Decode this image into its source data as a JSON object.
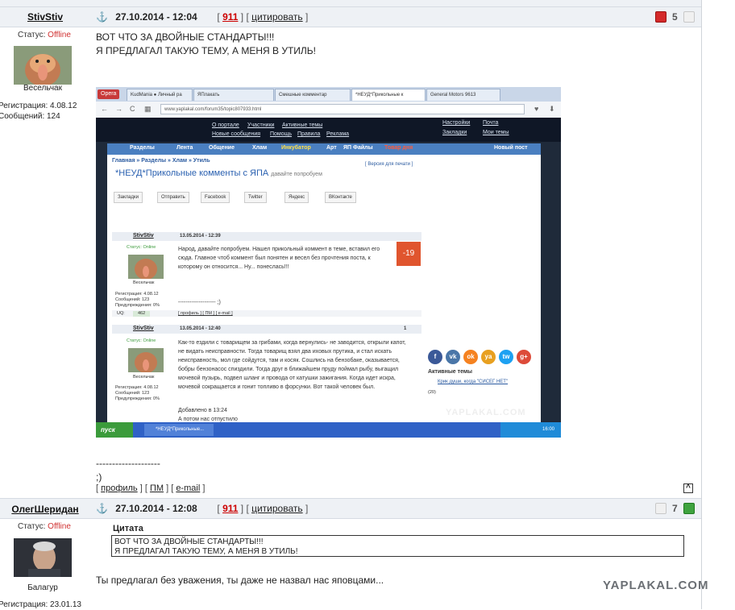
{
  "post1": {
    "author": "StivStiv",
    "status_label": "Статус:",
    "status_value": "Offline",
    "rank": "Весельчак",
    "reg": "Регистрация: 4.08.12",
    "msgs": "Сообщений: 124",
    "anchor": "⚓",
    "date": "27.10.2014 - 12:04",
    "num": "911",
    "quote_link": "цитировать",
    "text_line1": "ВОТ ЧТО ЗА ДВОЙНЫЕ СТАНДАРТЫ!!!",
    "text_line2": "Я ПРЕДЛАГАЛ ТАКУЮ ТЕМУ, А МЕНЯ В УТИЛЬ!",
    "signature_line": "--------------------",
    "signature_smile": ";)",
    "rating": "5",
    "links": {
      "profile": "профиль",
      "pm": "ПМ",
      "email": "e-mail"
    },
    "totop": "^"
  },
  "post2": {
    "author": "ОлегШеридан",
    "status_label": "Статус:",
    "status_value": "Offline",
    "rank": "Балагур",
    "reg": "Регистрация: 23.01.13",
    "anchor": "⚓",
    "date": "27.10.2014 - 12:08",
    "num": "911",
    "quote_link": "цитировать",
    "quote_title": "Цитата",
    "quote_line1": "ВОТ ЧТО ЗА ДВОЙНЫЕ СТАНДАРТЫ!!!",
    "quote_line2": "Я ПРЕДЛАГАЛ ТАКУЮ ТЕМУ, А МЕНЯ В УТИЛЬ!",
    "text": "Ты предлагал без уважения, ты даже не назвал нас яповцами...",
    "rating": "7"
  },
  "watermark": "YAPLAKAL.COM",
  "screenshot": {
    "opera_label": "Opera",
    "tabs": [
      "KudMania ● Личный ра",
      "ЯПлакать",
      "Смешные комментар",
      "*НЕУД*Прикольные к",
      "General Motors 9613"
    ],
    "url": "www.yaplakal.com/forum35/topic807933.html",
    "header_links": {
      "about": "О портале",
      "members": "Участники",
      "active": "Активные темы",
      "new_msgs": "Новые сообщения",
      "help": "Помощь",
      "rules": "Правила",
      "ads": "Реклама",
      "settings": "Настройки",
      "mail": "Почта",
      "bookmarks": "Закладки",
      "my_topics": "Мои темы"
    },
    "menu": [
      "Разделы",
      "Лента",
      "Общение",
      "Хлам",
      "Инкубатор",
      "Арт",
      "ЯП Файлы",
      "Товар дня",
      "Новый пост"
    ],
    "breadcrumb": "Главная » Разделы » Хлам » Утиль",
    "thread_title": "*НЕУД*Прикольные комменты с ЯПА",
    "thread_sub": "давайте попробуем",
    "print_link": "[ Версия для печати ]",
    "share": [
      "Закладки",
      "Отправить",
      "Facebook",
      "Twitter",
      "Яндекс",
      "ВКонтакте"
    ],
    "inner1": {
      "author": "StivStiv",
      "date": "13.05.2014 - 12:39",
      "status": "Статус: Online",
      "rank": "Весельчак",
      "stats1": "Регистрация: 4.08.12",
      "stats2": "Сообщений: 123",
      "stats3": "Предупреждения: 0%",
      "text": "Народ, давайте попробуем. Нашел прикольный коммент в теме, вставил его сюда. Главное чтоб коммент был понятен и весел без прочтения поста, к которому он относится... Ну... понеслась!!!",
      "sig": "-------------------- ;)",
      "uq": "UQ:",
      "uq_val": "462",
      "links": "[ профиль ] [ ПМ ] [ e-mail ]",
      "badge": "-19"
    },
    "inner2": {
      "author": "StivStiv",
      "date": "13.05.2014 - 12:40",
      "status": "Статус: Online",
      "rank": "Весельчак",
      "stats1": "Регистрация: 4.08.12",
      "stats2": "Сообщений: 123",
      "stats3": "Предупреждения: 0%",
      "rating": "1",
      "text": "Как-то ездили с товарищем за грибами, когда вернулись- не заводится, открыли капот, не видать неисправности. Тогда товарищ взял два иховых прутика, и стал искать неисправность, мол где сойдутся, там и косяк. Сошлись на бензобаке, оказывается, бобры бензонасос спиздили. Тогда друг в ближайшем пруду поймал рыбу, выгащил мочевой пузырь, подвел шланг и провода от катушки зажигания. Когда идет искра, мочевой сокращается и гонит топливо в форсунки. Вот такой человек был.",
      "added": "Добавлено в 13:24",
      "tail": "А потом нас отпустило"
    },
    "social": [
      "f",
      "vk",
      "ok",
      "ya",
      "tw",
      "g+"
    ],
    "active_title": "Активные темы",
    "active_link": "Крик души, когда \"СИСЕГ НЕТ\"",
    "active_count": "(20)",
    "watermark": "YAPLAKAL.COM",
    "start": "пуск",
    "task": "*НЕУД*Прикольные...",
    "clock": "16:00"
  }
}
